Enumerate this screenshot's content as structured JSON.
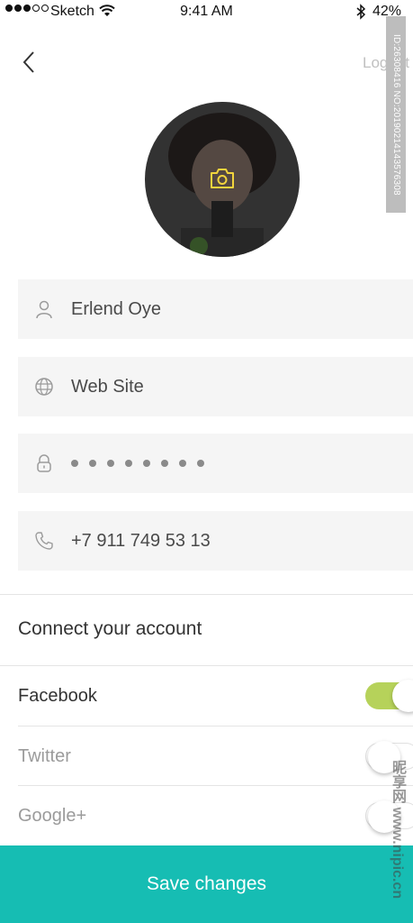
{
  "status_bar": {
    "carrier": "Sketch",
    "time": "9:41 AM",
    "battery": "42%"
  },
  "nav": {
    "logout_label": "Logout"
  },
  "watermark": {
    "id_text": "ID:26308416 NO:20190214143576308",
    "site_text": "昵享网 www.nipic.cn"
  },
  "profile": {
    "name": "Erlend Oye",
    "website_placeholder": "Web Site",
    "password_mask_length": 8,
    "phone": "+7 911 749 53 13"
  },
  "connect": {
    "title": "Connect your account",
    "accounts": [
      {
        "label": "Facebook",
        "connected": true
      },
      {
        "label": "Twitter",
        "connected": false
      },
      {
        "label": "Google+",
        "connected": false
      }
    ]
  },
  "save_button": {
    "label": "Save changes"
  },
  "colors": {
    "accent": "#16bdb3",
    "toggle_on": "#b6d25a",
    "field_bg": "#f5f5f5",
    "camera_icon": "#f2d43d"
  }
}
